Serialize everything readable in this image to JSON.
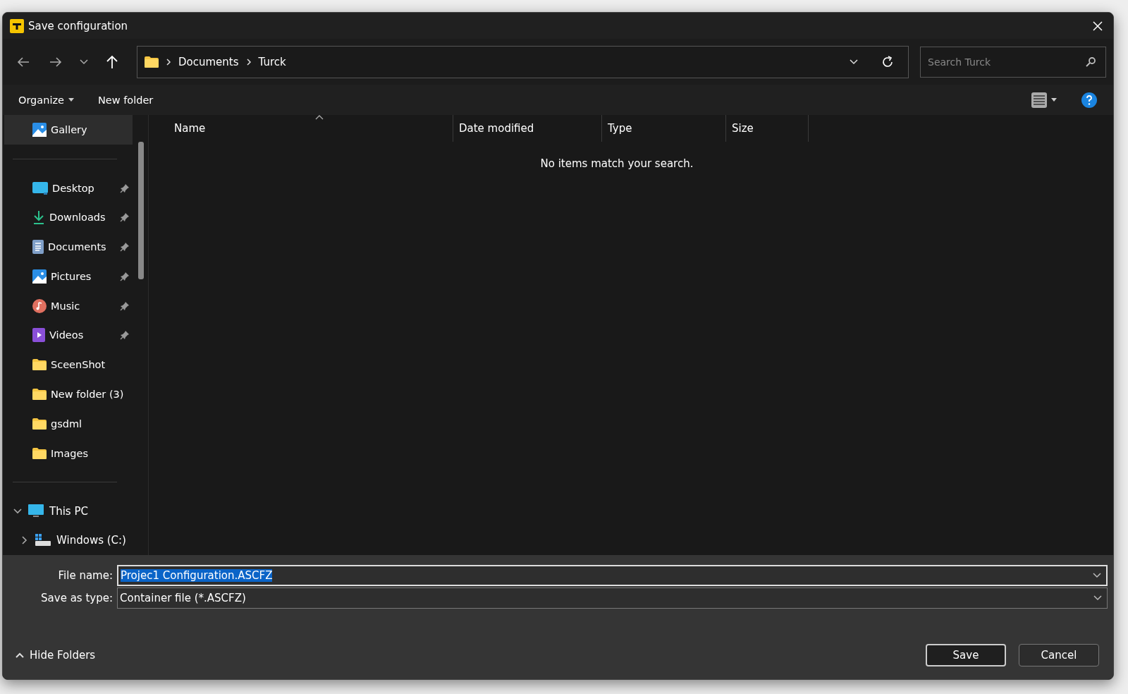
{
  "window": {
    "title": "Save configuration"
  },
  "breadcrumb": [
    "Documents",
    "Turck"
  ],
  "search": {
    "placeholder": "Search Turck"
  },
  "toolbar": {
    "organize": "Organize",
    "new_folder": "New folder"
  },
  "sidebar": {
    "items": [
      {
        "label": "Gallery",
        "kind": "quick",
        "selected": true,
        "pinned": false
      },
      {
        "label": "Desktop",
        "kind": "quick",
        "selected": false,
        "pinned": true
      },
      {
        "label": "Downloads",
        "kind": "quick",
        "selected": false,
        "pinned": true
      },
      {
        "label": "Documents",
        "kind": "quick",
        "selected": false,
        "pinned": true
      },
      {
        "label": "Pictures",
        "kind": "quick",
        "selected": false,
        "pinned": true
      },
      {
        "label": "Music",
        "kind": "quick",
        "selected": false,
        "pinned": true
      },
      {
        "label": "Videos",
        "kind": "quick",
        "selected": false,
        "pinned": true
      },
      {
        "label": "SceenShot",
        "kind": "folder",
        "selected": false,
        "pinned": false
      },
      {
        "label": "New folder (3)",
        "kind": "folder",
        "selected": false,
        "pinned": false
      },
      {
        "label": "gsdml",
        "kind": "folder",
        "selected": false,
        "pinned": false
      },
      {
        "label": "Images",
        "kind": "folder",
        "selected": false,
        "pinned": false
      }
    ],
    "tree": [
      {
        "label": "This PC",
        "expanded": true,
        "children": [
          {
            "label": "Windows (C:)",
            "expanded": false
          }
        ]
      }
    ]
  },
  "table": {
    "columns": [
      {
        "label": "Name",
        "sorted": true
      },
      {
        "label": "Date modified",
        "sorted": false
      },
      {
        "label": "Type",
        "sorted": false
      },
      {
        "label": "Size",
        "sorted": false
      }
    ],
    "empty_message": "No items match your search."
  },
  "form": {
    "file_name_label": "File name:",
    "file_name": "Projec1 Configuration.ASCFZ",
    "type_label": "Save as type:",
    "type": "Container file (*.ASCFZ)"
  },
  "hide_folders": "Hide Folders",
  "buttons": [
    {
      "label": "Save",
      "default": true
    },
    {
      "label": "Cancel",
      "default": false
    }
  ]
}
